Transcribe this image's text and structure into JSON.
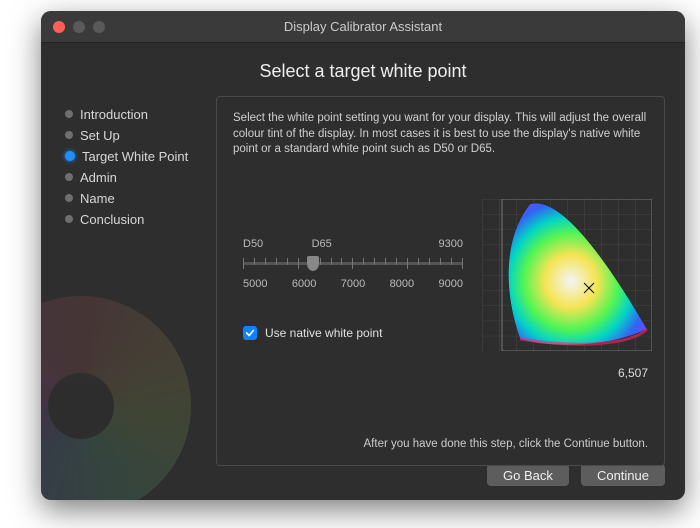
{
  "window": {
    "title": "Display Calibrator Assistant"
  },
  "heading": "Select a target white point",
  "sidebar": {
    "items": [
      {
        "label": "Introduction",
        "current": false
      },
      {
        "label": "Set Up",
        "current": false
      },
      {
        "label": "Target White Point",
        "current": true
      },
      {
        "label": "Admin",
        "current": false
      },
      {
        "label": "Name",
        "current": false
      },
      {
        "label": "Conclusion",
        "current": false
      }
    ]
  },
  "content": {
    "description": "Select the white point setting you want for your display. This will adjust the overall colour tint of the display. In most cases it is best to use the display's native white point or a standard white point such as D50 or D65.",
    "slider": {
      "top_labels": [
        "D50",
        "D65",
        "9300"
      ],
      "bottom_labels": [
        "5000",
        "6000",
        "7000",
        "8000",
        "9000"
      ]
    },
    "checkbox": {
      "checked": true,
      "label": "Use native white point"
    },
    "readout_value": "6,507",
    "hint": "After you have done this step, click the Continue button."
  },
  "footer": {
    "back_label": "Go Back",
    "continue_label": "Continue"
  }
}
